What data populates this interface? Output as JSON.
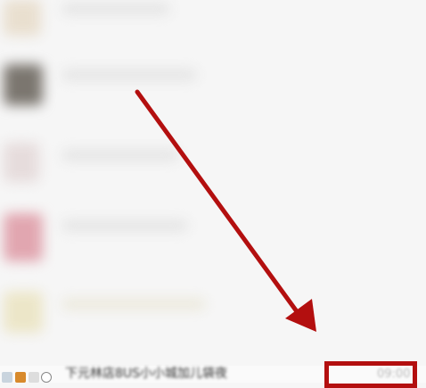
{
  "annotation": {
    "color": "#b30f0f",
    "arrow": "diagonal-arrow-icon"
  },
  "bottom_bar": {
    "text": "下元林店8US小小城加儿袋夜",
    "time": "09:00"
  }
}
